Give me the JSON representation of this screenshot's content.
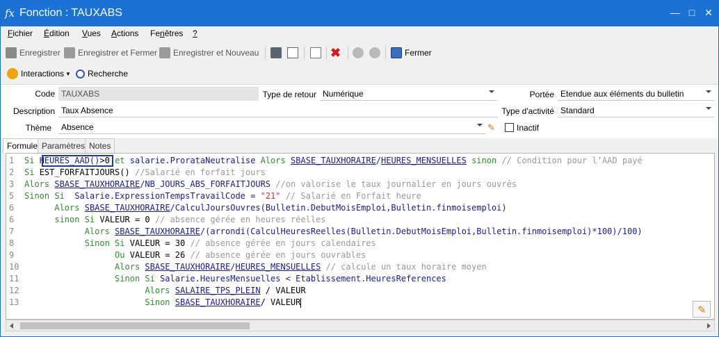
{
  "window": {
    "title": "Fonction : TAUXABS"
  },
  "menu": [
    {
      "label": "Fichier",
      "u": "F",
      "rest": "ichier"
    },
    {
      "label": "Édition",
      "u": "É",
      "rest": "dition"
    },
    {
      "label": "Vues",
      "u": "V",
      "rest": "ues"
    },
    {
      "label": "Actions",
      "u": "A",
      "rest": "ctions"
    },
    {
      "label": "Fenêtres",
      "u": "n",
      "pre": "Fe",
      "rest": "êtres"
    },
    {
      "label": "?",
      "u": "?",
      "rest": ""
    }
  ],
  "toolbar": {
    "enregistrer": "Enregistrer",
    "enregistrer_fermer": "Enregistrer et Fermer",
    "enregistrer_nouveau": "Enregistrer et Nouveau",
    "fermer": "Fermer"
  },
  "toolbar2": {
    "interactions": "Interactions",
    "recherche": "Recherche"
  },
  "form": {
    "code_label": "Code",
    "code_value": "TAUXABS",
    "description_label": "Description",
    "description_value": "Taux Absence",
    "theme_label": "Thème",
    "theme_value": "Absence",
    "type_retour_label": "Type de retour",
    "type_retour_value": "Numérique",
    "portee_label": "Portée",
    "portee_value": "Etendue aux éléments du bulletin",
    "type_activite_label": "Type d'activité",
    "type_activite_value": "Standard",
    "inactif_label": "Inactif"
  },
  "tabs": [
    "Formule",
    "Paramètres",
    "Notes"
  ],
  "code_lines": [
    {
      "n": "1",
      "parts": [
        [
          "kw",
          "Si "
        ],
        [
          "fn",
          "HEURES_AAD()"
        ],
        [
          "txt",
          ">0 "
        ],
        [
          "kw",
          "et "
        ],
        [
          "fn",
          "salarie.ProrataNeutralise "
        ],
        [
          "kw",
          "Alors "
        ],
        [
          "vr",
          "SBASE_TAUXHORAIRE"
        ],
        [
          "fn",
          "/"
        ],
        [
          "vr",
          "HEURES_MENSUELLES"
        ],
        [
          "kw",
          " sinon "
        ],
        [
          "cm",
          "// Condition pour l’AAD payé"
        ]
      ]
    },
    {
      "n": "2",
      "parts": [
        [
          "kw",
          "Si "
        ],
        [
          "txt",
          "EST_FORFAITJOURS() "
        ],
        [
          "cm",
          "//Salarié en forfait jours"
        ]
      ]
    },
    {
      "n": "3",
      "parts": [
        [
          "kw",
          "Alors "
        ],
        [
          "vr",
          "SBASE_TAUXHORAIRE"
        ],
        [
          "fn",
          "/NB_JOURS_ABS_FORFAITJOURS "
        ],
        [
          "cm",
          "//on valorise le taux journalier en jours ouvrés"
        ]
      ]
    },
    {
      "n": "5",
      "parts": [
        [
          "kw",
          "Sinon Si  "
        ],
        [
          "fn",
          "Salarie.ExpressionTempsTravailCode = "
        ],
        [
          "st",
          "\"21\""
        ],
        [
          "cm",
          " // Salarié en Forfait heure"
        ]
      ]
    },
    {
      "n": "6",
      "parts": [
        [
          "txt",
          "      "
        ],
        [
          "kw",
          "Alors "
        ],
        [
          "vr",
          "SBASE_TAUXHORAIRE"
        ],
        [
          "fn",
          "/CalculJoursOuvres(Bulletin.DebutMoisEmploi,Bulletin.finmoisemploi)"
        ]
      ]
    },
    {
      "n": "6",
      "parts": [
        [
          "txt",
          "      "
        ],
        [
          "kw",
          "sinon Si "
        ],
        [
          "txt",
          "VALEUR = 0 "
        ],
        [
          "cm",
          "// absence gérée en heures réelles"
        ]
      ]
    },
    {
      "n": "7",
      "parts": [
        [
          "txt",
          "            "
        ],
        [
          "kw",
          "Alors "
        ],
        [
          "vr",
          "SBASE_TAUXHORAIRE"
        ],
        [
          "fn",
          "/(arrondi(CalculHeuresReelles(Bulletin.DebutMoisEmploi,Bulletin.finmoisemploi)*100)/100)"
        ]
      ]
    },
    {
      "n": "8",
      "parts": [
        [
          "txt",
          "            "
        ],
        [
          "kw",
          "Sinon Si "
        ],
        [
          "txt",
          "VALEUR = 30 "
        ],
        [
          "cm",
          "// absence gérée en jours calendaires"
        ]
      ]
    },
    {
      "n": "9",
      "parts": [
        [
          "txt",
          "                  "
        ],
        [
          "kw",
          "Ou "
        ],
        [
          "txt",
          "VALEUR = 26 "
        ],
        [
          "cm",
          "// absence gérée en jours ouvrables"
        ]
      ]
    },
    {
      "n": "10",
      "parts": [
        [
          "txt",
          "                  "
        ],
        [
          "kw",
          "Alors "
        ],
        [
          "vr",
          "SBASE_TAUXHORAIRE"
        ],
        [
          "fn",
          "/"
        ],
        [
          "vr",
          "HEURES_MENSUELLES"
        ],
        [
          "cm",
          " // calcule un taux horaire moyen"
        ]
      ]
    },
    {
      "n": "11",
      "parts": [
        [
          "txt",
          "                  "
        ],
        [
          "kw",
          "Sinon Si "
        ],
        [
          "fn",
          "Salarie.HeuresMensuelles < Etablissement.HeuresReferences"
        ]
      ]
    },
    {
      "n": "12",
      "parts": [
        [
          "txt",
          "                        "
        ],
        [
          "kw",
          "Alors "
        ],
        [
          "vr",
          "SALAIRE_TPS_PLEIN"
        ],
        [
          "txt",
          " / VALEUR"
        ]
      ]
    },
    {
      "n": "13",
      "parts": [
        [
          "txt",
          "                        "
        ],
        [
          "kw",
          "Sinon "
        ],
        [
          "vr",
          "SBASE_TAUXHORAIRE"
        ],
        [
          "txt",
          "/ VALEUR"
        ]
      ]
    }
  ],
  "colors": {
    "titlebar": "#1a73d4",
    "keyword": "#2e8b2e",
    "comment": "#999999",
    "variable": "#1b1b8e",
    "string": "#c0392b"
  }
}
